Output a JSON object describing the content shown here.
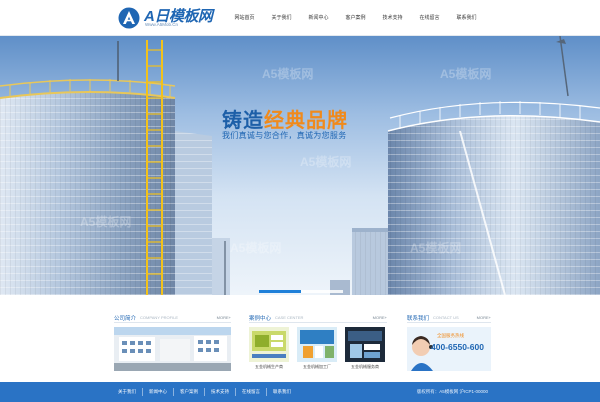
{
  "header": {
    "logo_text": "A日模板网",
    "logo_sub": "Www.A5Mob.Cn",
    "nav": [
      "网站首页",
      "关于我们",
      "新闻中心",
      "客户案例",
      "技术支持",
      "在线留言",
      "联系我们"
    ]
  },
  "hero": {
    "slogan_a": "铸造",
    "slogan_b": "经典品牌",
    "slogan_sub": "我们真诚与您合作，真诚为您服务",
    "slides": 2,
    "active_slide": 1
  },
  "sections": {
    "company": {
      "title": "公司简介",
      "en": "COMPANY PROFILE",
      "more": "MORE+"
    },
    "cases": {
      "title": "案例中心",
      "en": "CASE CENTER",
      "more": "MORE+",
      "items": [
        "五金机械生产商",
        "五金机械加工厂",
        "五金机械服务商"
      ]
    },
    "contact": {
      "title": "联系我们",
      "en": "CONTACT US",
      "more": "MORE+",
      "phone": "400-6550-600",
      "label": "全国服务热线"
    }
  },
  "footer": {
    "links": [
      "关于我们",
      "新闻中心",
      "客户案例",
      "技术支持",
      "在线留言",
      "联系我们"
    ],
    "copyright": "版权所有：A5模板网  沪ICP1-00000"
  },
  "colors": {
    "brand": "#1f66b3",
    "accent": "#f08a1c",
    "footer": "#2a73c5"
  }
}
